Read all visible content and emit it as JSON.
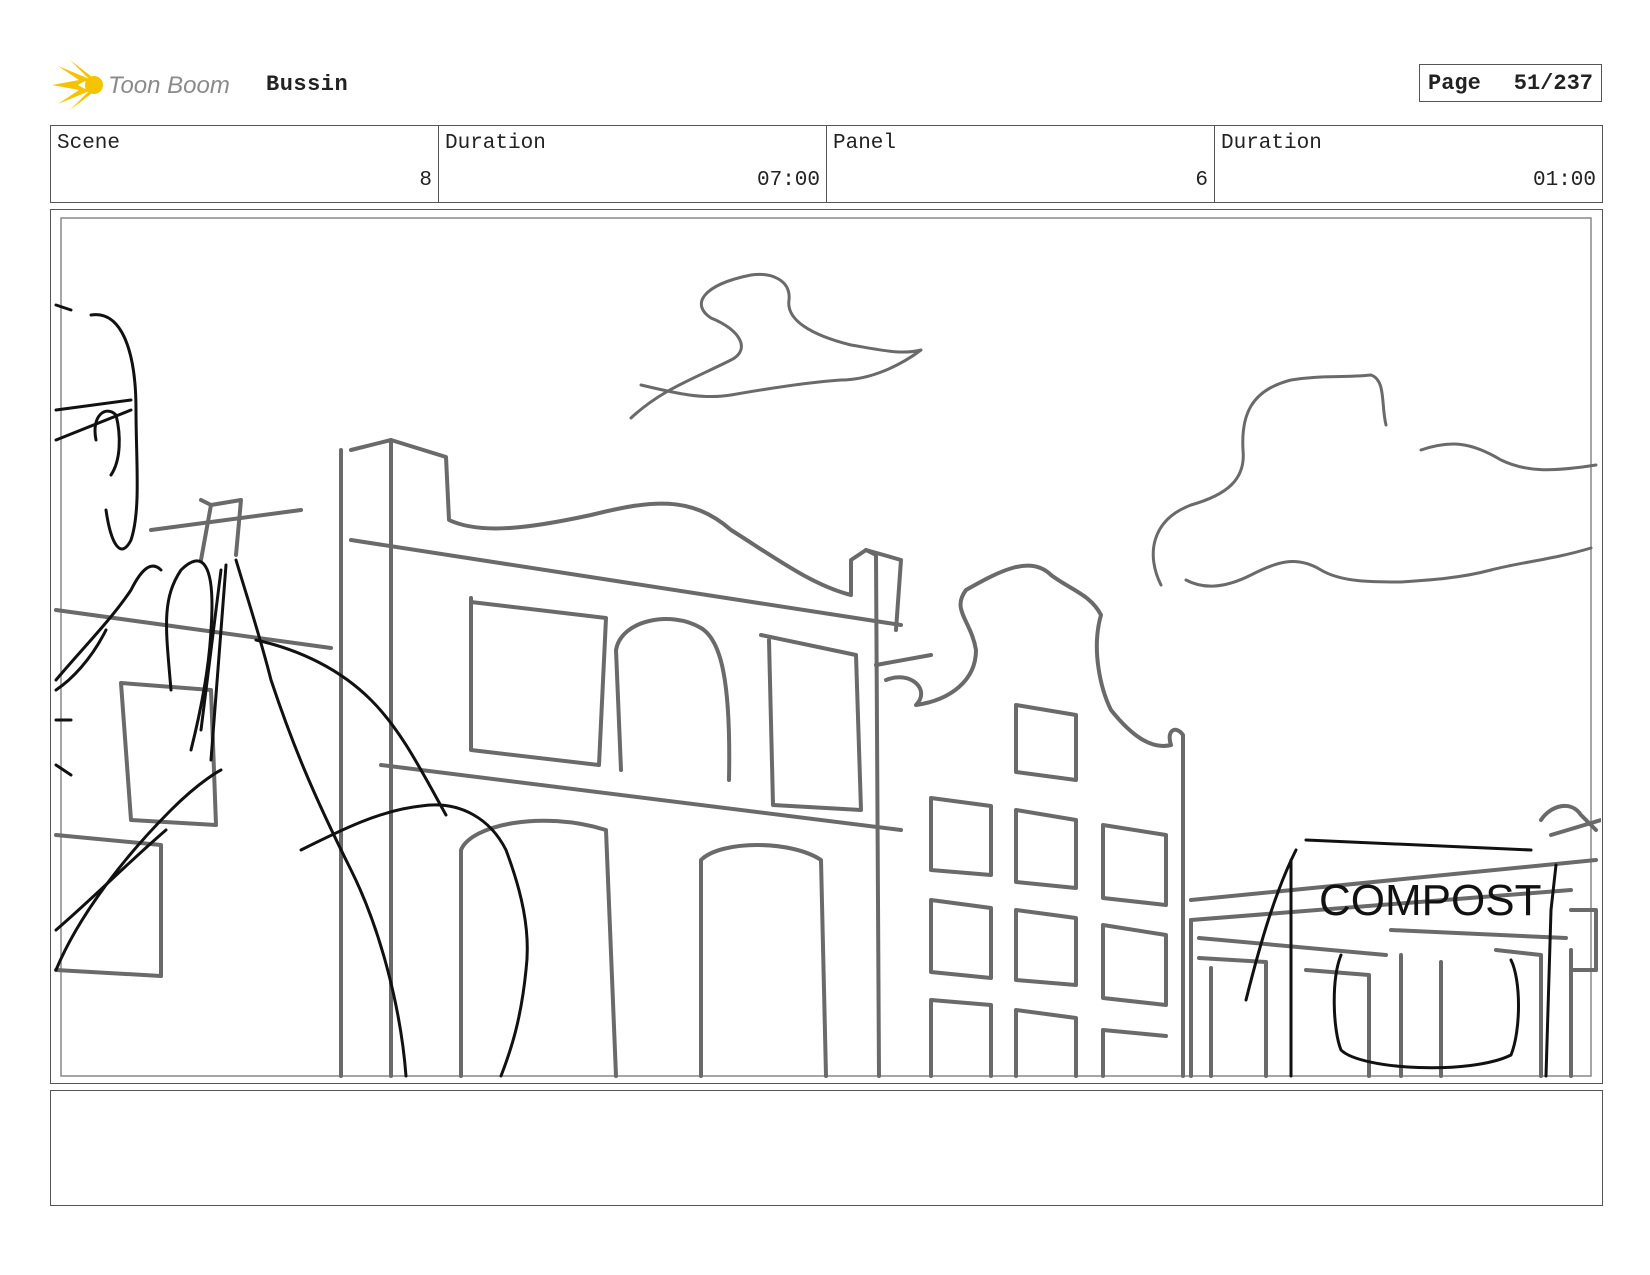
{
  "header": {
    "logo_text": "Toon Boom",
    "project_title": "Bussin",
    "page_label": "Page",
    "page_value": "51/237"
  },
  "info": {
    "scene_label": "Scene",
    "scene_value": "8",
    "scene_duration_label": "Duration",
    "scene_duration_value": "07:00",
    "panel_label": "Panel",
    "panel_value": "6",
    "panel_duration_label": "Duration",
    "panel_duration_value": "01:00"
  },
  "panel": {
    "sign_text": "COMPOST"
  },
  "notes": {
    "text": ""
  },
  "colors": {
    "logo_yellow": "#f5c400",
    "logo_gray": "#8a8a8a",
    "sketch_gray": "#6a6a6a",
    "sketch_black": "#111111",
    "border": "#555555"
  }
}
